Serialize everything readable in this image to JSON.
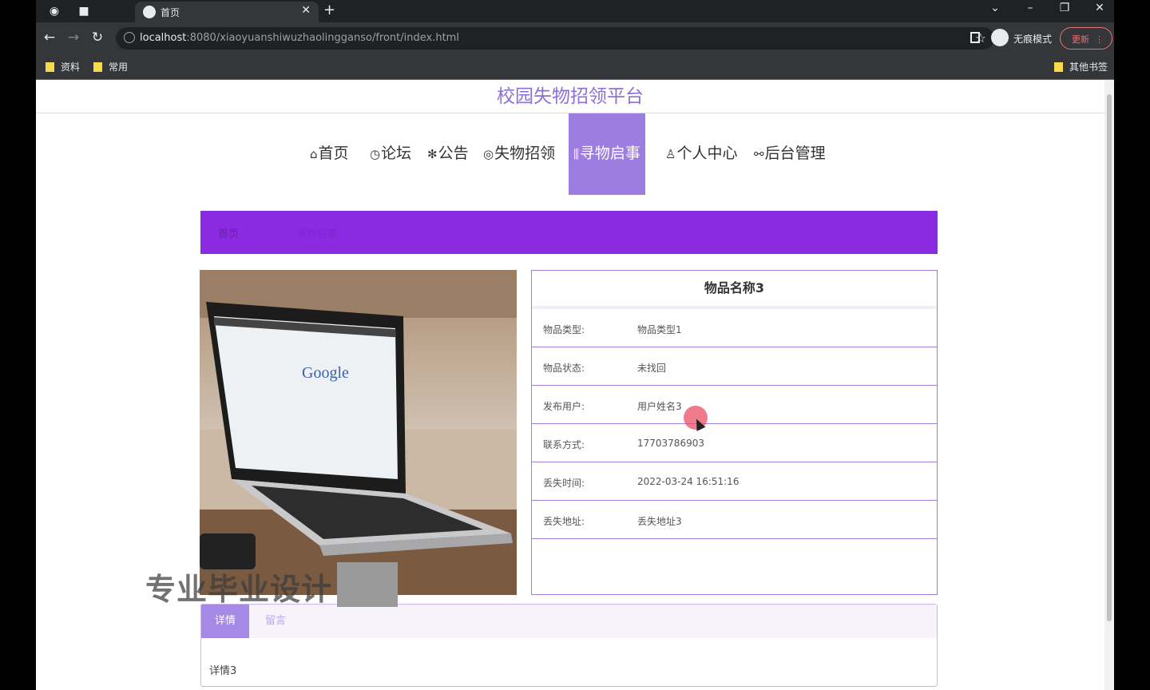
{
  "browser": {
    "tab_title": "首页",
    "url_host": "localhost",
    "url_path": ":8080/xiaoyuanshiwuzhaolingganso/front/index.html",
    "incognito_label": "无痕模式",
    "update_label": "更新",
    "bookmarks": [
      "资料",
      "常用"
    ],
    "other_bookmarks": "其他书签"
  },
  "site": {
    "title": "校园失物招领平台"
  },
  "nav": {
    "items": [
      {
        "icon": "⌂",
        "label": "首页"
      },
      {
        "icon": "◷",
        "label": "论坛"
      },
      {
        "icon": "✻",
        "label": "公告"
      },
      {
        "icon": "◎",
        "label": "失物招领"
      },
      {
        "icon": "⫼",
        "label": "寻物启事"
      },
      {
        "icon": "♙",
        "label": "个人中心"
      },
      {
        "icon": "⚯",
        "label": "后台管理"
      }
    ]
  },
  "breadcrumb": {
    "home": "首页",
    "current": "寻物启事"
  },
  "item": {
    "name": "物品名称3",
    "rows": [
      {
        "label": "物品类型:",
        "value": "物品类型1"
      },
      {
        "label": "物品状态:",
        "value": "未找回"
      },
      {
        "label": "发布用户:",
        "value": "用户姓名3"
      },
      {
        "label": "联系方式:",
        "value": "17703786903"
      },
      {
        "label": "丢失时间:",
        "value": "2022-03-24 16:51:16"
      },
      {
        "label": "丢失地址:",
        "value": "丢失地址3"
      }
    ]
  },
  "photo": {
    "screen_text": "Google"
  },
  "watermark": "专业毕业设计",
  "detail": {
    "tab_detail": "详情",
    "tab_comment": "留言",
    "content": "详情3"
  },
  "colors": {
    "accent": "#9e7de0",
    "breadcrumb_bg": "#8a2be2",
    "title": "#8e6fd8"
  }
}
